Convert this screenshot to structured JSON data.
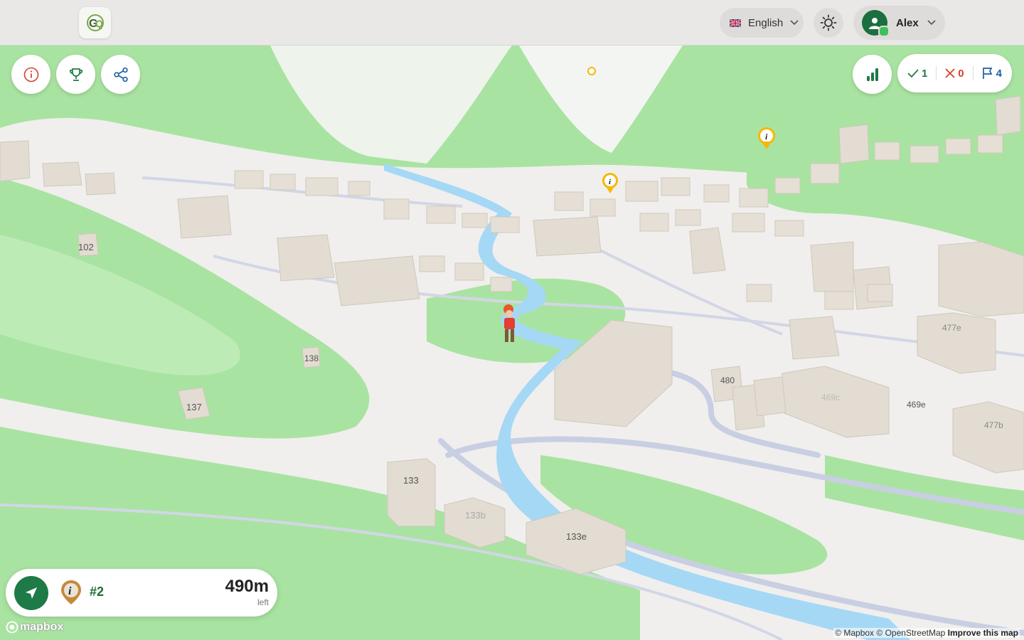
{
  "topbar": {
    "language": "English",
    "user_name": "Alex"
  },
  "toolbar": {
    "stats": {
      "correct": "1",
      "wrong": "0",
      "flags": "4"
    }
  },
  "map": {
    "labels": [
      "102",
      "138",
      "137",
      "133",
      "133b",
      "133e",
      "480",
      "469c",
      "469e",
      "477e",
      "477b"
    ],
    "attribution": {
      "mapbox": "© Mapbox",
      "osm": "© OpenStreetMap",
      "improve": "Improve this map"
    },
    "logo_text": "mapbox"
  },
  "navigation": {
    "waypoint": "#2",
    "distance": "490m",
    "distance_suffix": "left"
  },
  "colors": {
    "accent": "#1e7a46",
    "park": "#a9e3a1",
    "water": "#a5d8f5",
    "building": "#e2dcd2"
  }
}
